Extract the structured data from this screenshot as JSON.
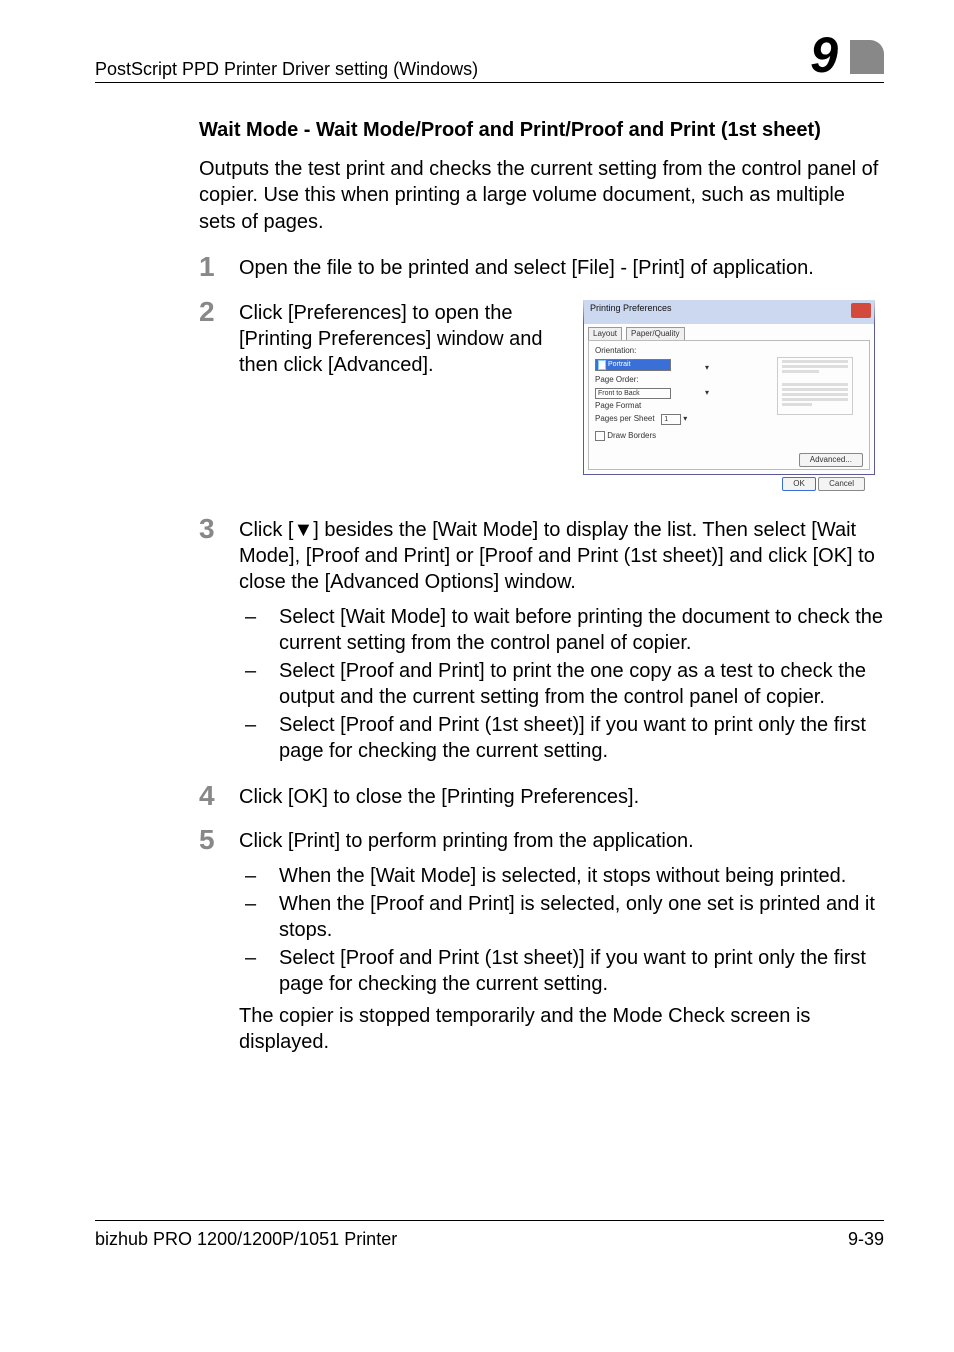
{
  "header": {
    "title": "PostScript PPD Printer Driver setting (Windows)",
    "chapter_number": "9"
  },
  "section": {
    "title": "Wait Mode - Wait Mode/Proof and Print/Proof and Print (1st sheet)",
    "intro": "Outputs the test print and checks the current setting from the control panel of copier. Use this when printing a large volume document, such as multiple sets of pages."
  },
  "steps": {
    "s1": {
      "num": "1",
      "text": "Open the file to be printed and select [File] - [Print] of application."
    },
    "s2": {
      "num": "2",
      "text": "Click [Preferences] to open the [Printing Preferences] window and then click [Advanced]."
    },
    "s3": {
      "num": "3",
      "text": "Click [▼] besides the [Wait Mode] to display the list. Then select [Wait Mode], [Proof and Print] or [Proof and Print (1st sheet)] and click [OK] to close the [Advanced Options] window.",
      "subs": [
        "Select [Wait Mode] to wait before printing the document to check the current setting from the control panel of copier.",
        "Select [Proof and Print] to print the one copy as a test to check the output and the current setting from the control panel of copier.",
        "Select [Proof and Print (1st sheet)] if you want to print only the first page for checking the current setting."
      ]
    },
    "s4": {
      "num": "4",
      "text": "Click [OK] to close the [Printing Preferences]."
    },
    "s5": {
      "num": "5",
      "text": "Click [Print] to perform printing from the application.",
      "subs": [
        "When the [Wait Mode] is selected, it stops without being printed.",
        "When the [Proof and Print] is selected, only one set is printed and it stops.",
        "Select [Proof and Print (1st sheet)] if you want to print only the first page for checking the current setting."
      ],
      "after": "The copier is stopped temporarily and the Mode Check screen is displayed."
    }
  },
  "screenshot": {
    "window_title": "Printing Preferences",
    "tab1": "Layout",
    "tab2": "Paper/Quality",
    "orientation_label": "Orientation:",
    "orientation_value": "Portrait",
    "page_order_label": "Page Order:",
    "page_order_value": "Front to Back",
    "page_format_label": "Page Format",
    "pps_label": "Pages per Sheet",
    "pps_value": "1",
    "draw_borders": "Draw Borders",
    "advanced_btn": "Advanced...",
    "ok_btn": "OK",
    "cancel_btn": "Cancel"
  },
  "footer": {
    "left": "bizhub PRO 1200/1200P/1051 Printer",
    "right": "9-39"
  }
}
